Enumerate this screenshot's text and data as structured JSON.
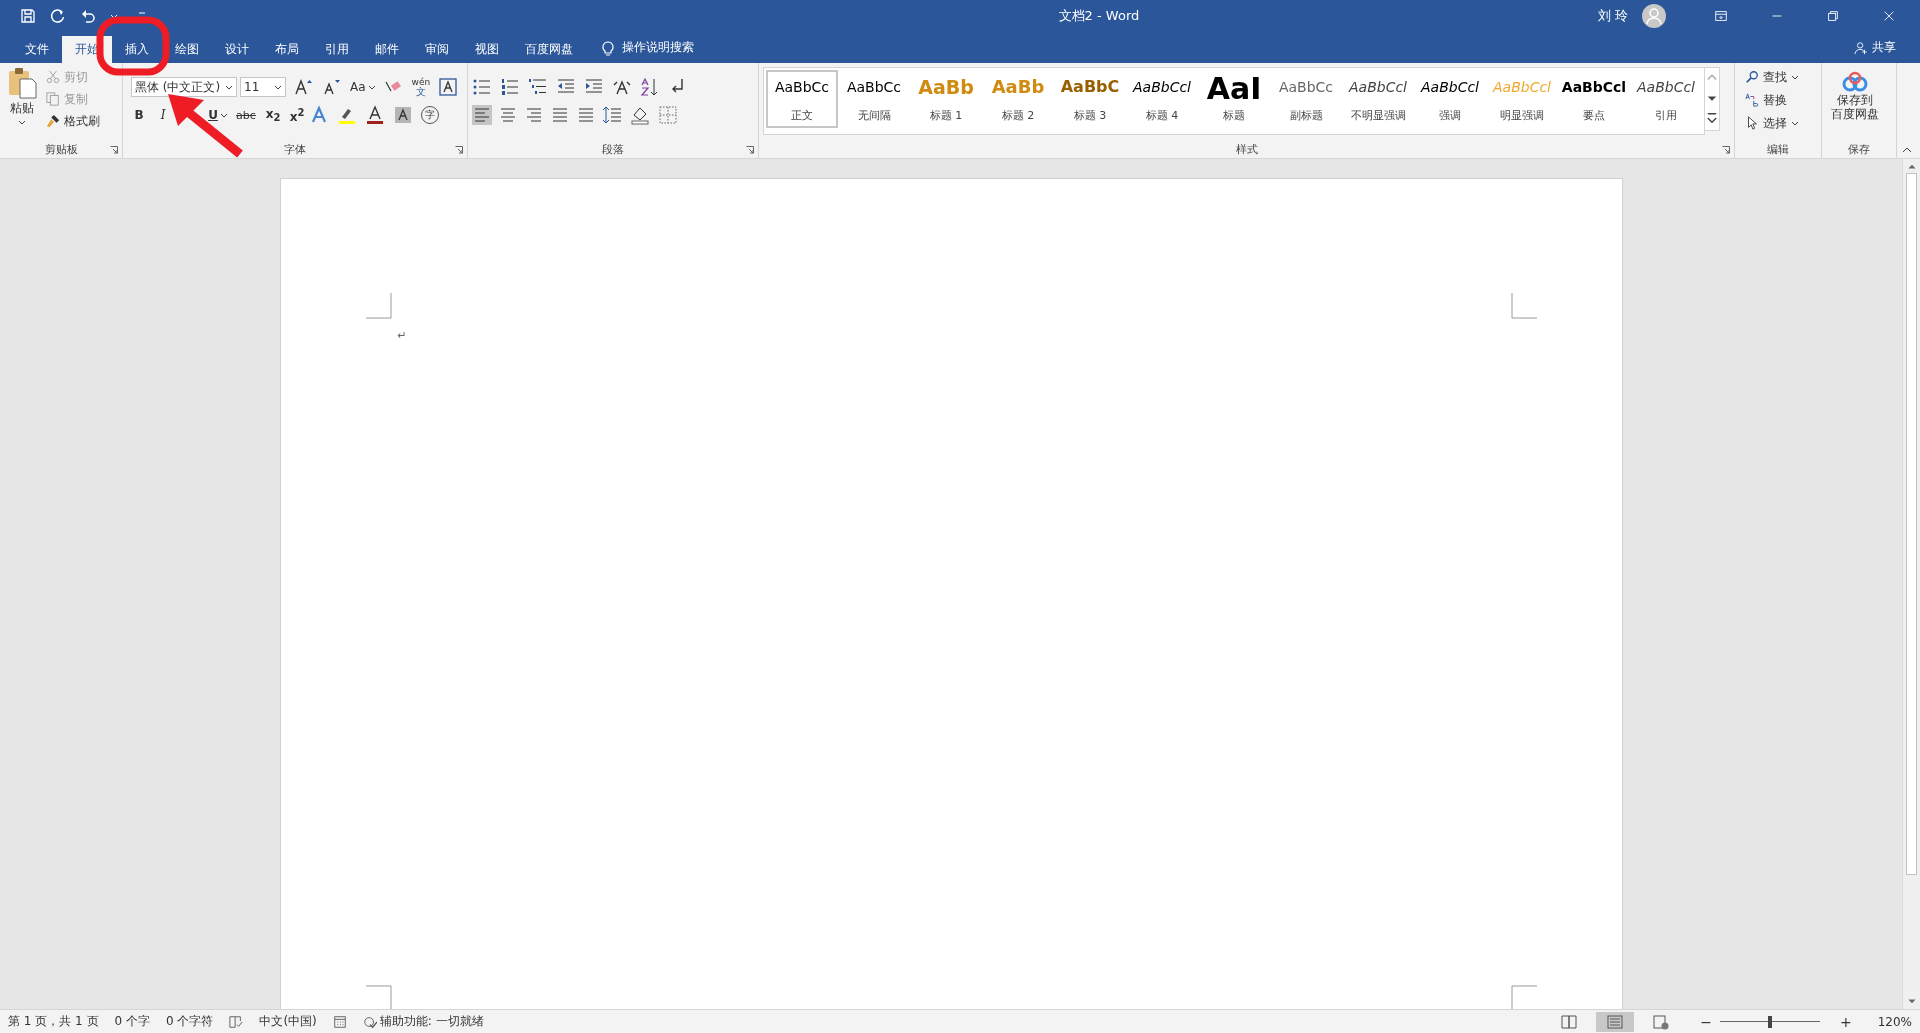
{
  "window": {
    "title": "文档2  -  Word",
    "user": "刘 玲"
  },
  "tabs": [
    {
      "label": "文件",
      "selected": false
    },
    {
      "label": "开始",
      "selected": true
    },
    {
      "label": "插入",
      "selected": false
    },
    {
      "label": "绘图",
      "selected": false
    },
    {
      "label": "设计",
      "selected": false
    },
    {
      "label": "布局",
      "selected": false
    },
    {
      "label": "引用",
      "selected": false
    },
    {
      "label": "邮件",
      "selected": false
    },
    {
      "label": "审阅",
      "selected": false
    },
    {
      "label": "视图",
      "selected": false
    },
    {
      "label": "百度网盘",
      "selected": false
    }
  ],
  "tell_me": "操作说明搜索",
  "share": "共享",
  "clipboard": {
    "group": "剪贴板",
    "paste": "粘贴",
    "cut": {
      "label": "剪切",
      "disabled": true
    },
    "copy": {
      "label": "复制",
      "disabled": true
    },
    "format_painter": "格式刷"
  },
  "font": {
    "group": "字体",
    "name": "黑体 (中文正文)",
    "size": "11",
    "change_case": "Aa",
    "phonetic_top": "wén",
    "phonetic_bottom": "文",
    "bold": "B",
    "italic": "I",
    "underline": "U",
    "strike": "abc",
    "subscript": "x$_{2}$",
    "superscript": "x$^{2}$",
    "enclose": "字"
  },
  "paragraph": {
    "group": "段落",
    "alignments": [
      {
        "kind": "left",
        "selected": true
      },
      {
        "kind": "center",
        "selected": false
      },
      {
        "kind": "right",
        "selected": false
      },
      {
        "kind": "justify",
        "selected": false
      },
      {
        "kind": "distributed",
        "selected": false
      }
    ]
  },
  "styles": {
    "group": "样式",
    "items": [
      {
        "kind": "normal",
        "sample": "AaBbCc",
        "label": "正文",
        "selected": true
      },
      {
        "kind": "no-spacing",
        "sample": "AaBbCc",
        "label": "无间隔",
        "selected": false
      },
      {
        "kind": "heading1",
        "sample": "AaBb",
        "label": "标题 1",
        "selected": false
      },
      {
        "kind": "heading2",
        "sample": "AaBb",
        "label": "标题 2",
        "selected": false
      },
      {
        "kind": "heading3",
        "sample": "AaBbC",
        "label": "标题 3",
        "selected": false
      },
      {
        "kind": "heading4",
        "sample": "AaBbCcl",
        "label": "标题 4",
        "selected": false
      },
      {
        "kind": "title",
        "sample": "AaI",
        "label": "标题",
        "selected": false
      },
      {
        "kind": "subtitle",
        "sample": "AaBbCc",
        "label": "副标题",
        "selected": false
      },
      {
        "kind": "subtle",
        "sample": "AaBbCcl",
        "label": "不明显强调",
        "selected": false
      },
      {
        "kind": "emphasis",
        "sample": "AaBbCcl",
        "label": "强调",
        "selected": false
      },
      {
        "kind": "intense",
        "sample": "AaBbCcl",
        "label": "明显强调",
        "selected": false
      },
      {
        "kind": "strong",
        "sample": "AaBbCcl",
        "label": "要点",
        "selected": false
      },
      {
        "kind": "quote",
        "sample": "AaBbCcl",
        "label": "引用",
        "selected": false
      }
    ]
  },
  "editing": {
    "group": "编辑",
    "find": "查找",
    "replace": "替换",
    "select": "选择"
  },
  "save": {
    "group": "保存",
    "line1": "保存到",
    "line2": "百度网盘"
  },
  "document": {
    "paragraph_mark": "↵"
  },
  "status": {
    "page": "第 1 页，共 1 页",
    "words": "0 个字",
    "chars": "0 个字符",
    "language": "中文(中国)",
    "accessibility": "辅助功能: 一切就绪",
    "views": [
      {
        "kind": "read",
        "selected": false
      },
      {
        "kind": "print",
        "selected": true
      },
      {
        "kind": "web",
        "selected": false
      }
    ],
    "zoom": {
      "minus": "−",
      "plus": "+",
      "level": 0.5,
      "percent": "120%"
    }
  }
}
